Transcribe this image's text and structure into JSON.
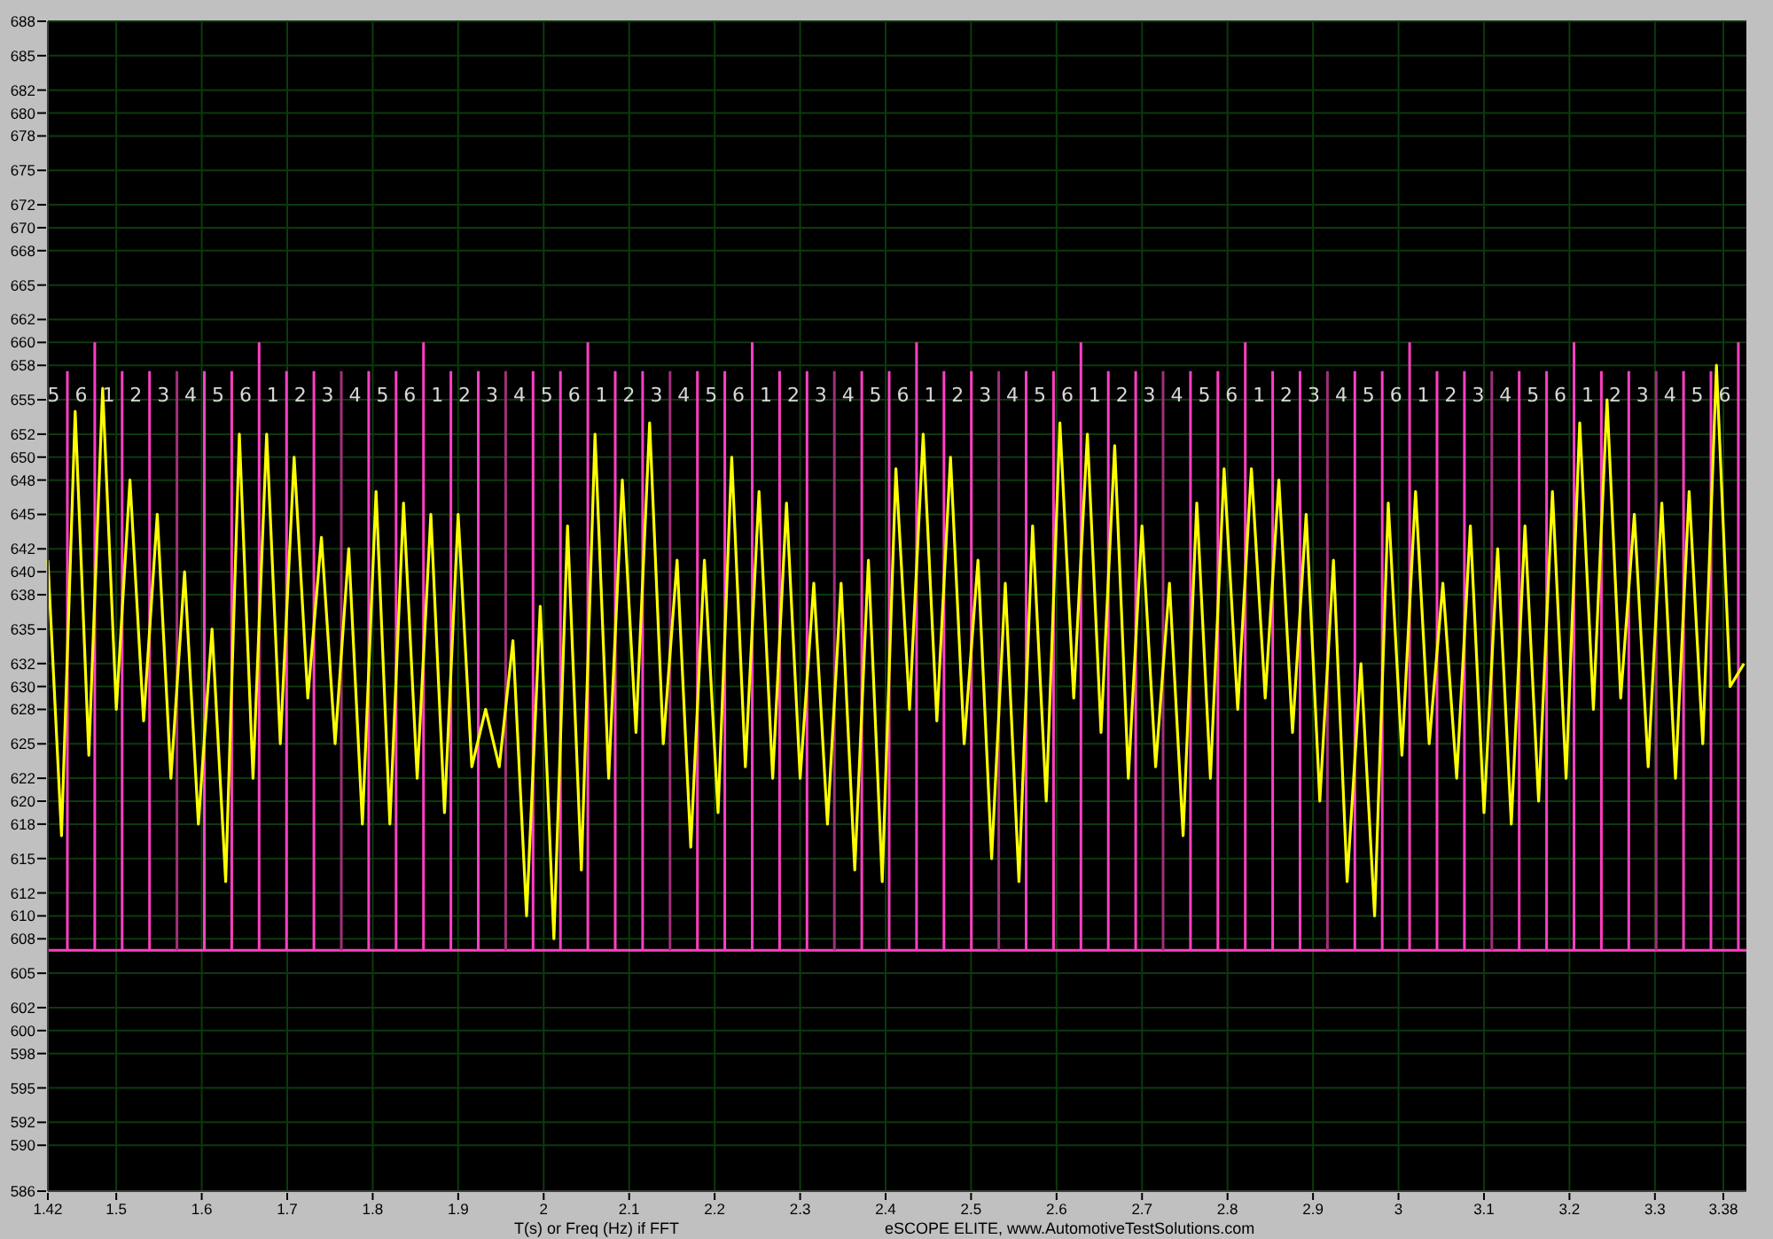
{
  "chart": {
    "chart_data": {
      "type": "line",
      "grid": true,
      "ref_lines": [
        {
          "axis": "y",
          "value": 607,
          "color": "#ff3fc0"
        }
      ],
      "xlabel": "T(s) or Freq (Hz) if FFT",
      "xlim": [
        1.42,
        3.407
      ],
      "ylim": [
        586,
        688
      ],
      "xticks": [
        {
          "value": 1.42,
          "label": "1.42"
        },
        {
          "value": 1.5,
          "label": "1.5"
        },
        {
          "value": 1.6,
          "label": "1.6"
        },
        {
          "value": 1.7,
          "label": "1.7"
        },
        {
          "value": 1.8,
          "label": "1.8"
        },
        {
          "value": 1.9,
          "label": "1.9"
        },
        {
          "value": 2,
          "label": "2"
        },
        {
          "value": 2.1,
          "label": "2.1"
        },
        {
          "value": 2.2,
          "label": "2.2"
        },
        {
          "value": 2.3,
          "label": "2.3"
        },
        {
          "value": 2.4,
          "label": "2.4"
        },
        {
          "value": 2.5,
          "label": "2.5"
        },
        {
          "value": 2.6,
          "label": "2.6"
        },
        {
          "value": 2.7,
          "label": "2.7"
        },
        {
          "value": 2.8,
          "label": "2.8"
        },
        {
          "value": 2.9,
          "label": "2.9"
        },
        {
          "value": 3,
          "label": "3"
        },
        {
          "value": 3.1,
          "label": "3.1"
        },
        {
          "value": 3.2,
          "label": "3.2"
        },
        {
          "value": 3.3,
          "label": "3.3"
        },
        {
          "value": 3.38,
          "label": "3.38"
        }
      ],
      "yticks": [
        {
          "value": 688,
          "label": "688"
        },
        {
          "value": 685,
          "label": "685"
        },
        {
          "value": 682,
          "label": "682"
        },
        {
          "value": 680,
          "label": "680"
        },
        {
          "value": 678,
          "label": "678"
        },
        {
          "value": 675,
          "label": "675"
        },
        {
          "value": 672,
          "label": "672"
        },
        {
          "value": 670,
          "label": "670"
        },
        {
          "value": 668,
          "label": "668"
        },
        {
          "value": 665,
          "label": "665"
        },
        {
          "value": 662,
          "label": "662"
        },
        {
          "value": 660,
          "label": "660"
        },
        {
          "value": 658,
          "label": "658"
        },
        {
          "value": 655,
          "label": "655"
        },
        {
          "value": 652,
          "label": "652"
        },
        {
          "value": 650,
          "label": "650"
        },
        {
          "value": 648,
          "label": "648"
        },
        {
          "value": 645,
          "label": "645"
        },
        {
          "value": 642,
          "label": "642"
        },
        {
          "value": 640,
          "label": "640"
        },
        {
          "value": 638,
          "label": "638"
        },
        {
          "value": 635,
          "label": "635"
        },
        {
          "value": 632,
          "label": "632"
        },
        {
          "value": 630,
          "label": "630"
        },
        {
          "value": 628,
          "label": "628"
        },
        {
          "value": 625,
          "label": "625"
        },
        {
          "value": 622,
          "label": "622"
        },
        {
          "value": 620,
          "label": "620"
        },
        {
          "value": 618,
          "label": "618"
        },
        {
          "value": 615,
          "label": "615"
        },
        {
          "value": 612,
          "label": "612"
        },
        {
          "value": 610,
          "label": "610"
        },
        {
          "value": 608,
          "label": "608"
        },
        {
          "value": 605,
          "label": "605"
        },
        {
          "value": 602,
          "label": "602"
        },
        {
          "value": 600,
          "label": "600"
        },
        {
          "value": 598,
          "label": "598"
        },
        {
          "value": 595,
          "label": "595"
        },
        {
          "value": 592,
          "label": "592"
        },
        {
          "value": 590,
          "label": "590"
        },
        {
          "value": 586,
          "label": "586"
        }
      ],
      "x": [
        1.42,
        1.436,
        1.452,
        1.468,
        1.484,
        1.5,
        1.516,
        1.532,
        1.548,
        1.564,
        1.58,
        1.596,
        1.612,
        1.628,
        1.644,
        1.66,
        1.676,
        1.692,
        1.708,
        1.724,
        1.74,
        1.756,
        1.772,
        1.788,
        1.804,
        1.82,
        1.836,
        1.852,
        1.868,
        1.884,
        1.9,
        1.916,
        1.932,
        1.948,
        1.964,
        1.98,
        1.996,
        2.012,
        2.028,
        2.044,
        2.06,
        2.076,
        2.092,
        2.108,
        2.124,
        2.14,
        2.156,
        2.172,
        2.188,
        2.204,
        2.22,
        2.236,
        2.252,
        2.268,
        2.284,
        2.3,
        2.316,
        2.332,
        2.348,
        2.364,
        2.38,
        2.396,
        2.412,
        2.428,
        2.444,
        2.46,
        2.476,
        2.492,
        2.508,
        2.524,
        2.54,
        2.556,
        2.572,
        2.588,
        2.604,
        2.62,
        2.636,
        2.652,
        2.668,
        2.684,
        2.7,
        2.716,
        2.732,
        2.748,
        2.764,
        2.78,
        2.796,
        2.812,
        2.828,
        2.844,
        2.86,
        2.876,
        2.892,
        2.908,
        2.924,
        2.94,
        2.956,
        2.972,
        2.988,
        3.004,
        3.02,
        3.036,
        3.052,
        3.068,
        3.084,
        3.1,
        3.116,
        3.132,
        3.148,
        3.164,
        3.18,
        3.196,
        3.212,
        3.228,
        3.244,
        3.26,
        3.276,
        3.292,
        3.308,
        3.324,
        3.34,
        3.356,
        3.372,
        3.388,
        3.404
      ],
      "series": [
        {
          "color": "#ffff00",
          "values": [
            641,
            617,
            654,
            624,
            656,
            628,
            648,
            627,
            645,
            622,
            640,
            618,
            635,
            613,
            652,
            622,
            652,
            625,
            650,
            629,
            643,
            625,
            642,
            618,
            647,
            618,
            646,
            622,
            645,
            619,
            645,
            623,
            628,
            623,
            634,
            610,
            637,
            608,
            644,
            614,
            652,
            622,
            648,
            626,
            653,
            625,
            641,
            616,
            641,
            619,
            650,
            623,
            647,
            622,
            646,
            622,
            639,
            618,
            639,
            614,
            641,
            613,
            649,
            628,
            652,
            627,
            650,
            625,
            641,
            615,
            639,
            613,
            644,
            620,
            653,
            629,
            652,
            626,
            651,
            622,
            644,
            623,
            639,
            617,
            646,
            622,
            649,
            628,
            649,
            629,
            648,
            626,
            645,
            620,
            641,
            613,
            632,
            610,
            646,
            624,
            647,
            625,
            639,
            622,
            644,
            619,
            642,
            618,
            644,
            620,
            647,
            622,
            653,
            628,
            655,
            629,
            645,
            623,
            646,
            622,
            647,
            625,
            658,
            630,
            632
          ]
        }
      ]
    },
    "cylinder_markers": [
      {
        "label": "5",
        "tall_line": false
      },
      {
        "label": "6",
        "tall_line": true
      },
      {
        "label": "1",
        "tall_line": false
      },
      {
        "label": "2",
        "tall_line": false
      },
      {
        "label": "3",
        "tall_line": false
      },
      {
        "label": "4",
        "tall_line": false
      },
      {
        "label": "5",
        "tall_line": false
      },
      {
        "label": "6",
        "tall_line": true
      },
      {
        "label": "1",
        "tall_line": false
      },
      {
        "label": "2",
        "tall_line": false
      },
      {
        "label": "3",
        "tall_line": false
      },
      {
        "label": "4",
        "tall_line": false
      },
      {
        "label": "5",
        "tall_line": false
      },
      {
        "label": "6",
        "tall_line": true
      },
      {
        "label": "1",
        "tall_line": false
      },
      {
        "label": "2",
        "tall_line": false
      },
      {
        "label": "3",
        "tall_line": false
      },
      {
        "label": "4",
        "tall_line": false
      },
      {
        "label": "5",
        "tall_line": false
      },
      {
        "label": "6",
        "tall_line": true
      },
      {
        "label": "1",
        "tall_line": false
      },
      {
        "label": "2",
        "tall_line": false
      },
      {
        "label": "3",
        "tall_line": false
      },
      {
        "label": "4",
        "tall_line": false
      },
      {
        "label": "5",
        "tall_line": false
      },
      {
        "label": "6",
        "tall_line": true
      },
      {
        "label": "1",
        "tall_line": false
      },
      {
        "label": "2",
        "tall_line": false
      },
      {
        "label": "3",
        "tall_line": false
      },
      {
        "label": "4",
        "tall_line": false
      },
      {
        "label": "5",
        "tall_line": false
      },
      {
        "label": "6",
        "tall_line": true
      },
      {
        "label": "1",
        "tall_line": false
      },
      {
        "label": "2",
        "tall_line": false
      },
      {
        "label": "3",
        "tall_line": false
      },
      {
        "label": "4",
        "tall_line": false
      },
      {
        "label": "5",
        "tall_line": false
      },
      {
        "label": "6",
        "tall_line": true
      },
      {
        "label": "1",
        "tall_line": false
      },
      {
        "label": "2",
        "tall_line": false
      },
      {
        "label": "3",
        "tall_line": false
      },
      {
        "label": "4",
        "tall_line": false
      },
      {
        "label": "5",
        "tall_line": false
      },
      {
        "label": "6",
        "tall_line": true
      },
      {
        "label": "1",
        "tall_line": false
      },
      {
        "label": "2",
        "tall_line": false
      },
      {
        "label": "3",
        "tall_line": false
      },
      {
        "label": "4",
        "tall_line": false
      },
      {
        "label": "5",
        "tall_line": false
      },
      {
        "label": "6",
        "tall_line": true
      },
      {
        "label": "1",
        "tall_line": false
      },
      {
        "label": "2",
        "tall_line": false
      },
      {
        "label": "3",
        "tall_line": false
      },
      {
        "label": "4",
        "tall_line": false
      },
      {
        "label": "5",
        "tall_line": false
      },
      {
        "label": "6",
        "tall_line": true
      },
      {
        "label": "1",
        "tall_line": false
      },
      {
        "label": "2",
        "tall_line": false
      },
      {
        "label": "3",
        "tall_line": false
      },
      {
        "label": "4",
        "tall_line": false
      },
      {
        "label": "5",
        "tall_line": false
      },
      {
        "label": "6",
        "tall_line": true
      }
    ]
  },
  "footer": "eSCOPE ELITE, www.AutomotiveTestSolutions.com"
}
